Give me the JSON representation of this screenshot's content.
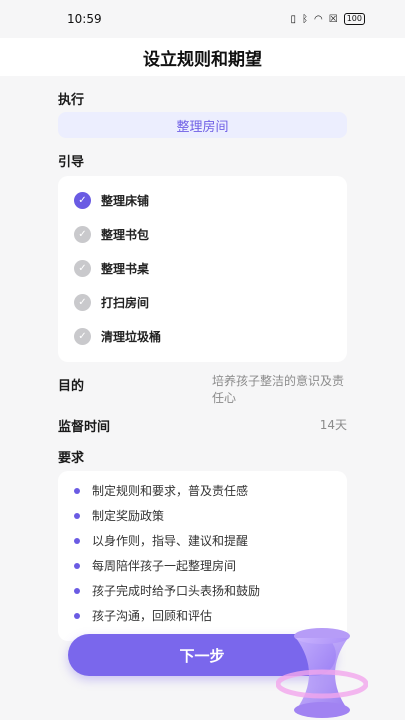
{
  "status_bar": {
    "time": "10:59",
    "battery": "100",
    "icons": [
      "vibrate-icon",
      "bluetooth-icon",
      "wifi-icon",
      "close-box-icon",
      "battery-icon"
    ]
  },
  "header": {
    "title": "设立规则和期望"
  },
  "execute": {
    "label": "执行",
    "value": "整理房间"
  },
  "guide": {
    "label": "引导",
    "items": [
      {
        "label": "整理床铺",
        "checked": true
      },
      {
        "label": "整理书包",
        "checked": false
      },
      {
        "label": "整理书桌",
        "checked": false
      },
      {
        "label": "打扫房间",
        "checked": false
      },
      {
        "label": "清理垃圾桶",
        "checked": false
      }
    ]
  },
  "purpose": {
    "label": "目的",
    "value": "培养孩子整洁的意识及责任心"
  },
  "duration": {
    "label": "监督时间",
    "value": "14天"
  },
  "requirements": {
    "label": "要求",
    "items": [
      "制定规则和要求，普及责任感",
      "制定奖励政策",
      "以身作则，指导、建议和提醒",
      "每周陪伴孩子一起整理房间",
      "孩子完成时给予口头表扬和鼓励",
      "孩子沟通，回顾和评估"
    ]
  },
  "footer": {
    "next_label": "下一步"
  },
  "colors": {
    "accent": "#7a67ec",
    "accent_light": "#eceefe",
    "check_off": "#c9c9cc"
  }
}
